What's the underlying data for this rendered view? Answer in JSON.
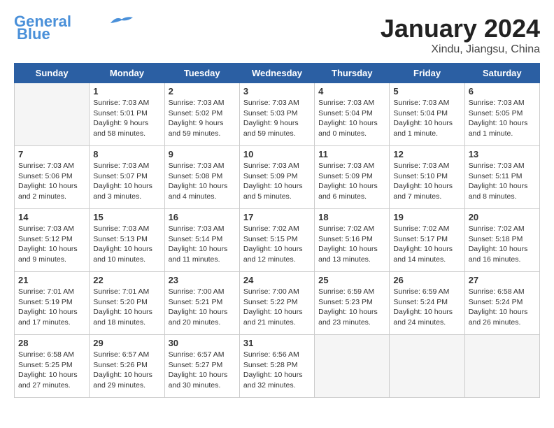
{
  "header": {
    "logo_line1": "General",
    "logo_line2": "Blue",
    "month": "January 2024",
    "location": "Xindu, Jiangsu, China"
  },
  "weekdays": [
    "Sunday",
    "Monday",
    "Tuesday",
    "Wednesday",
    "Thursday",
    "Friday",
    "Saturday"
  ],
  "weeks": [
    [
      {
        "day": "",
        "info": "",
        "empty": true
      },
      {
        "day": "1",
        "info": "Sunrise: 7:03 AM\nSunset: 5:01 PM\nDaylight: 9 hours\nand 58 minutes."
      },
      {
        "day": "2",
        "info": "Sunrise: 7:03 AM\nSunset: 5:02 PM\nDaylight: 9 hours\nand 59 minutes."
      },
      {
        "day": "3",
        "info": "Sunrise: 7:03 AM\nSunset: 5:03 PM\nDaylight: 9 hours\nand 59 minutes."
      },
      {
        "day": "4",
        "info": "Sunrise: 7:03 AM\nSunset: 5:04 PM\nDaylight: 10 hours\nand 0 minutes."
      },
      {
        "day": "5",
        "info": "Sunrise: 7:03 AM\nSunset: 5:04 PM\nDaylight: 10 hours\nand 1 minute."
      },
      {
        "day": "6",
        "info": "Sunrise: 7:03 AM\nSunset: 5:05 PM\nDaylight: 10 hours\nand 1 minute."
      }
    ],
    [
      {
        "day": "7",
        "info": "Sunrise: 7:03 AM\nSunset: 5:06 PM\nDaylight: 10 hours\nand 2 minutes."
      },
      {
        "day": "8",
        "info": "Sunrise: 7:03 AM\nSunset: 5:07 PM\nDaylight: 10 hours\nand 3 minutes."
      },
      {
        "day": "9",
        "info": "Sunrise: 7:03 AM\nSunset: 5:08 PM\nDaylight: 10 hours\nand 4 minutes."
      },
      {
        "day": "10",
        "info": "Sunrise: 7:03 AM\nSunset: 5:09 PM\nDaylight: 10 hours\nand 5 minutes."
      },
      {
        "day": "11",
        "info": "Sunrise: 7:03 AM\nSunset: 5:09 PM\nDaylight: 10 hours\nand 6 minutes."
      },
      {
        "day": "12",
        "info": "Sunrise: 7:03 AM\nSunset: 5:10 PM\nDaylight: 10 hours\nand 7 minutes."
      },
      {
        "day": "13",
        "info": "Sunrise: 7:03 AM\nSunset: 5:11 PM\nDaylight: 10 hours\nand 8 minutes."
      }
    ],
    [
      {
        "day": "14",
        "info": "Sunrise: 7:03 AM\nSunset: 5:12 PM\nDaylight: 10 hours\nand 9 minutes."
      },
      {
        "day": "15",
        "info": "Sunrise: 7:03 AM\nSunset: 5:13 PM\nDaylight: 10 hours\nand 10 minutes."
      },
      {
        "day": "16",
        "info": "Sunrise: 7:03 AM\nSunset: 5:14 PM\nDaylight: 10 hours\nand 11 minutes."
      },
      {
        "day": "17",
        "info": "Sunrise: 7:02 AM\nSunset: 5:15 PM\nDaylight: 10 hours\nand 12 minutes."
      },
      {
        "day": "18",
        "info": "Sunrise: 7:02 AM\nSunset: 5:16 PM\nDaylight: 10 hours\nand 13 minutes."
      },
      {
        "day": "19",
        "info": "Sunrise: 7:02 AM\nSunset: 5:17 PM\nDaylight: 10 hours\nand 14 minutes."
      },
      {
        "day": "20",
        "info": "Sunrise: 7:02 AM\nSunset: 5:18 PM\nDaylight: 10 hours\nand 16 minutes."
      }
    ],
    [
      {
        "day": "21",
        "info": "Sunrise: 7:01 AM\nSunset: 5:19 PM\nDaylight: 10 hours\nand 17 minutes."
      },
      {
        "day": "22",
        "info": "Sunrise: 7:01 AM\nSunset: 5:20 PM\nDaylight: 10 hours\nand 18 minutes."
      },
      {
        "day": "23",
        "info": "Sunrise: 7:00 AM\nSunset: 5:21 PM\nDaylight: 10 hours\nand 20 minutes."
      },
      {
        "day": "24",
        "info": "Sunrise: 7:00 AM\nSunset: 5:22 PM\nDaylight: 10 hours\nand 21 minutes."
      },
      {
        "day": "25",
        "info": "Sunrise: 6:59 AM\nSunset: 5:23 PM\nDaylight: 10 hours\nand 23 minutes."
      },
      {
        "day": "26",
        "info": "Sunrise: 6:59 AM\nSunset: 5:24 PM\nDaylight: 10 hours\nand 24 minutes."
      },
      {
        "day": "27",
        "info": "Sunrise: 6:58 AM\nSunset: 5:24 PM\nDaylight: 10 hours\nand 26 minutes."
      }
    ],
    [
      {
        "day": "28",
        "info": "Sunrise: 6:58 AM\nSunset: 5:25 PM\nDaylight: 10 hours\nand 27 minutes."
      },
      {
        "day": "29",
        "info": "Sunrise: 6:57 AM\nSunset: 5:26 PM\nDaylight: 10 hours\nand 29 minutes."
      },
      {
        "day": "30",
        "info": "Sunrise: 6:57 AM\nSunset: 5:27 PM\nDaylight: 10 hours\nand 30 minutes."
      },
      {
        "day": "31",
        "info": "Sunrise: 6:56 AM\nSunset: 5:28 PM\nDaylight: 10 hours\nand 32 minutes."
      },
      {
        "day": "",
        "info": "",
        "empty": true
      },
      {
        "day": "",
        "info": "",
        "empty": true
      },
      {
        "day": "",
        "info": "",
        "empty": true
      }
    ]
  ]
}
